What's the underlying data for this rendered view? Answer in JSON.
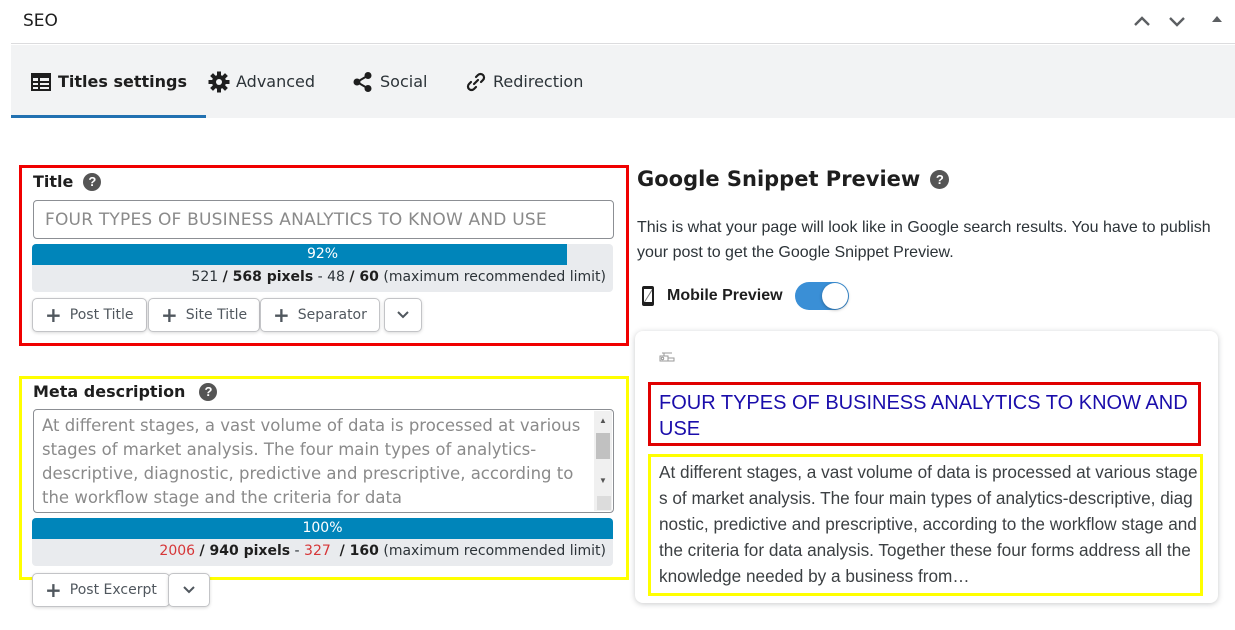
{
  "panel": {
    "title": "SEO",
    "controls": [
      "move-up",
      "move-down",
      "collapse"
    ]
  },
  "tabs": [
    {
      "label": "Titles settings",
      "icon": "table-icon",
      "active": true
    },
    {
      "label": "Advanced",
      "icon": "gear-icon",
      "active": false
    },
    {
      "label": "Social",
      "icon": "share-icon",
      "active": false
    },
    {
      "label": "Redirection",
      "icon": "link-icon",
      "active": false
    }
  ],
  "title_field": {
    "label": "Title",
    "value": "FOUR TYPES OF BUSINESS ANALYTICS TO KNOW AND USE",
    "meter": {
      "percent": 92,
      "percent_label": "92%",
      "pixels_used": "521",
      "pixels_max": "568 pixels",
      "chars_used": "48",
      "chars_max": "60",
      "note": "(maximum recommended limit)"
    },
    "tag_buttons": [
      "Post Title",
      "Site Title",
      "Separator"
    ]
  },
  "meta_field": {
    "label": "Meta description",
    "value": "At different stages, a vast volume of data is processed at various stages of market analysis. The four main types of analytics-descriptive, diagnostic, predictive and prescriptive, according to the workflow stage and the criteria for data",
    "meter": {
      "percent": 100,
      "percent_label": "100%",
      "pixels_used": "2006",
      "pixels_max": "940 pixels",
      "chars_used": "327",
      "chars_max": "160",
      "note": "(maximum recommended limit)"
    },
    "tag_buttons": [
      "Post Excerpt"
    ]
  },
  "snippet": {
    "heading": "Google Snippet Preview",
    "description": "This is what your page will look like in Google search results. You have to publish your post to get the Google Snippet Preview.",
    "mobile_label": "Mobile Preview",
    "mobile_enabled": true,
    "result_title": "FOUR TYPES OF BUSINESS ANALYTICS TO KNOW AND USE",
    "result_description": "At different stages, a vast volume of data is processed at various stages of market analysis. The four main types of analytics-descriptive, diagnostic, predictive and prescriptive, according to the workflow stage and the criteria for data analysis. Together these four forms address all the knowledge needed by a business from…"
  },
  "colors": {
    "accent": "#0085ba",
    "tab_underline": "#2271b1",
    "over_limit": "#d63638",
    "toggle_on": "#3a8fd6",
    "google_title": "#1a0dab",
    "highlight_red": "#f00000",
    "highlight_yellow": "#ffff00"
  }
}
